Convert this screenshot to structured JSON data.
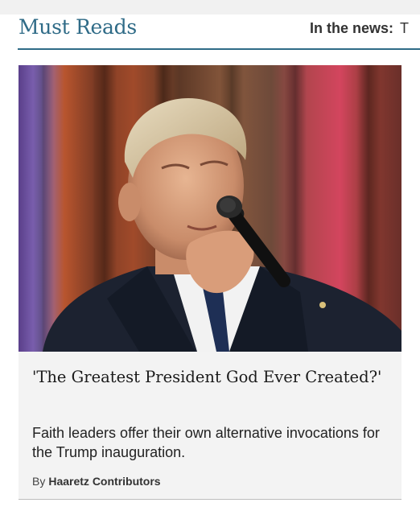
{
  "section": {
    "title": "Must Reads",
    "news_label": "In the news:",
    "news_headline": "T"
  },
  "colors": {
    "accent": "#2f6b87",
    "card_background": "#f3f3f3"
  },
  "article": {
    "image_alt_icon": "photo-icon",
    "headline": "'The Greatest President God Ever Created?'",
    "dek": "Faith leaders offer their own alternative invocations for the Trump inauguration.",
    "byline_prefix": "By",
    "author": "Haaretz Contributors"
  }
}
